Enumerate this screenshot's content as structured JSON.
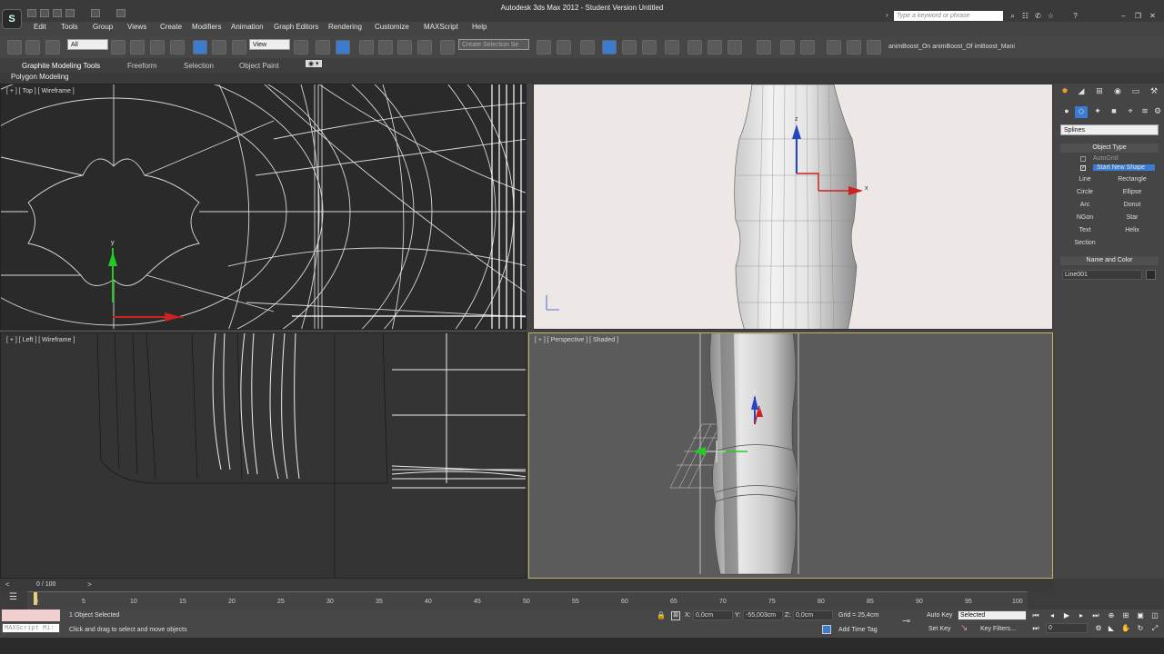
{
  "app": {
    "title": "Autodesk 3ds Max  2012  - Student Version    Untitled"
  },
  "search": {
    "placeholder": "Type a keyword or phrase"
  },
  "menu": [
    "Edit",
    "Tools",
    "Group",
    "Views",
    "Create",
    "Modifiers",
    "Animation",
    "Graph Editors",
    "Rendering",
    "Customize",
    "MAXScript",
    "Help"
  ],
  "toolbar": {
    "filter": "All",
    "ref_coord": "View",
    "sel_set": "Create Selection Se",
    "anim_layers": "animBoost_On animBoost_Of imBoost_Mani"
  },
  "ribbon": {
    "tabs": [
      "Graphite Modeling Tools",
      "Freeform",
      "Selection",
      "Object Paint"
    ],
    "sub": "Polygon Modeling"
  },
  "viewports": {
    "top": "[ + ] [ Top ] [ Wireframe ]",
    "left": "[ + ] [ Left ] [ Wireframe ]",
    "persp": "[ + ] [ Perspective ] [ Shaded ]"
  },
  "axes": {
    "x": "x",
    "y": "y",
    "z": "z"
  },
  "panel": {
    "category": "Splines",
    "object_type": "Object Type",
    "autogrid": "AutoGrid",
    "start_new_shape": "Start New Shape",
    "buttons": [
      [
        "Line",
        "Rectangle"
      ],
      [
        "Circle",
        "Ellipse"
      ],
      [
        "Arc",
        "Donut"
      ],
      [
        "NGon",
        "Star"
      ],
      [
        "Text",
        "Helix"
      ],
      [
        "Section",
        ""
      ]
    ],
    "name_color": "Name and Color",
    "name": "Line001"
  },
  "timeline": {
    "frame": "0 / 100",
    "ticks": [
      "0",
      "5",
      "10",
      "15",
      "20",
      "25",
      "30",
      "35",
      "40",
      "45",
      "50",
      "55",
      "60",
      "65",
      "70",
      "75",
      "80",
      "85",
      "90",
      "95",
      "100"
    ]
  },
  "status": {
    "selected": "1 Object Selected",
    "prompt": "Click and drag to select and move objects",
    "maxscript": "MAXScript Mi:",
    "x": "0,0cm",
    "y": "-55,003cm",
    "z": "0,0cm",
    "grid": "Grid = 25,4cm",
    "auto_key": "Auto Key",
    "key_mode": "Selected",
    "set_key": "Set Key",
    "key_filters": "Key Filters...",
    "add_time_tag": "Add Time Tag",
    "cur_frame": "0",
    "x_label": "X:",
    "y_label": "Y:",
    "z_label": "Z:"
  }
}
